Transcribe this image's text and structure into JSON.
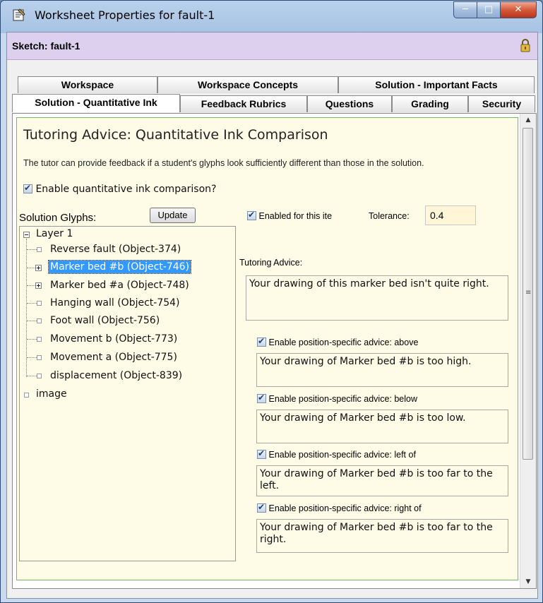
{
  "window": {
    "title": "Worksheet Properties for fault-1"
  },
  "sketch": {
    "label": "Sketch: fault-1"
  },
  "tabs": {
    "row1": [
      {
        "label": "Workspace"
      },
      {
        "label": "Workspace Concepts"
      },
      {
        "label": "Solution - Important Facts"
      }
    ],
    "row2": [
      {
        "label": "Solution - Quantitative Ink",
        "active": true
      },
      {
        "label": "Feedback Rubrics"
      },
      {
        "label": "Questions"
      },
      {
        "label": "Grading"
      },
      {
        "label": "Security"
      }
    ]
  },
  "content": {
    "heading": "Tutoring Advice:  Quantitative Ink Comparison",
    "description": "The tutor can provide feedback if a student's glyphs look sufficiently different than those in the solution.",
    "enable_label": "Enable quantitative ink comparison?",
    "enable_checked": true
  },
  "glyphs": {
    "label": "Solution Glyphs:",
    "update_button": "Update",
    "tree": {
      "layer": "Layer 1",
      "items": [
        {
          "label": "Reverse fault (Object-374)",
          "expandable": false
        },
        {
          "label": "Marker bed #b (Object-746)",
          "expandable": true,
          "selected": true
        },
        {
          "label": "Marker bed #a (Object-748)",
          "expandable": true
        },
        {
          "label": "Hanging wall (Object-754)",
          "expandable": false
        },
        {
          "label": "Foot wall (Object-756)",
          "expandable": false
        },
        {
          "label": "Movement b (Object-773)",
          "expandable": false
        },
        {
          "label": "Movement a (Object-775)",
          "expandable": false
        },
        {
          "label": "displacement (Object-839)",
          "expandable": false
        }
      ],
      "image": "image"
    }
  },
  "item": {
    "enabled_label": "Enabled for this ite",
    "enabled_checked": true,
    "tolerance_label": "Tolerance:",
    "tolerance_value": "0.4",
    "tutoring_advice_label": "Tutoring Advice:",
    "tutoring_advice_text": "Your drawing of this marker bed isn't quite right.",
    "positions": [
      {
        "label": "Enable position-specific advice: above",
        "checked": true,
        "text": "Your drawing of Marker bed #b is too high."
      },
      {
        "label": "Enable position-specific advice: below",
        "checked": true,
        "text": "Your drawing of Marker bed #b is too low."
      },
      {
        "label": "Enable position-specific advice: left of",
        "checked": true,
        "text": "Your drawing of Marker bed #b is too far to the left."
      },
      {
        "label": "Enable position-specific advice: right of",
        "checked": true,
        "text": "Your drawing of Marker bed #b is too far to the right."
      }
    ]
  },
  "icons": {
    "app": "worksheet-icon",
    "lock": "lock-icon",
    "minimize": "minimize-icon",
    "maximize": "maximize-icon",
    "close": "close-icon"
  }
}
